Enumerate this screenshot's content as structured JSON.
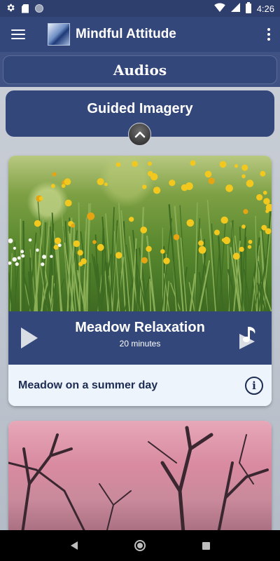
{
  "status_bar": {
    "time": "4:26",
    "icons": [
      "gear-icon",
      "sd-card-icon",
      "circle-icon",
      "wifi-icon",
      "signal-icon",
      "battery-icon"
    ]
  },
  "app_bar": {
    "title": "Mindful Attitude",
    "menu_icon": "hamburger-menu-icon",
    "overflow_icon": "more-vert-icon",
    "logo": "app-logo"
  },
  "section": {
    "title": "Audios"
  },
  "category": {
    "title": "Guided Imagery",
    "toggle_icon": "chevron-up-icon"
  },
  "audios": [
    {
      "title": "Meadow Relaxation",
      "duration": "20 minutes",
      "description": "Meadow on a summer day",
      "image": "meadow-photo"
    },
    {
      "image": "sunset-trees-photo"
    }
  ],
  "colors": {
    "primary": "#34477a",
    "status_bar": "#2e3f6e",
    "card_bg": "#eef4fb",
    "text_dark": "#1d2c52",
    "nav_bar": "#000000"
  },
  "nav_bar": {
    "icons": [
      "back-icon",
      "home-icon",
      "recents-icon"
    ]
  }
}
